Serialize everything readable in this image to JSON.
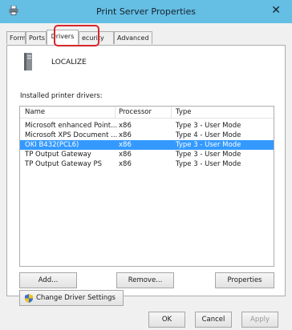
{
  "window": {
    "title": "Print Server Properties",
    "close_glyph": "✕"
  },
  "tabs": [
    {
      "label": "Forms"
    },
    {
      "label": "Ports"
    },
    {
      "label": "Drivers"
    },
    {
      "label": "ecurity"
    },
    {
      "label": "Advanced"
    }
  ],
  "active_tab": "Drivers",
  "server": {
    "name": "LOCALIZE",
    "icon": "print-server-icon"
  },
  "drivers_section": {
    "label": "Installed printer drivers:",
    "columns": [
      "Name",
      "Processor",
      "Type"
    ],
    "rows": [
      {
        "name": "Microsoft enhanced Point...",
        "processor": "x86",
        "type": "Type 3 - User Mode"
      },
      {
        "name": "Microsoft XPS Document ...",
        "processor": "x86",
        "type": "Type 4 - User Mode"
      },
      {
        "name": "OKI B432(PCL6)",
        "processor": "x86",
        "type": "Type 3 - User Mode"
      },
      {
        "name": "TP Output Gateway",
        "processor": "x86",
        "type": "Type 3 - User Mode"
      },
      {
        "name": "TP Output Gateway PS",
        "processor": "x86",
        "type": "Type 3 - User Mode"
      }
    ],
    "selected_row": 2
  },
  "buttons": {
    "add": "Add...",
    "remove": "Remove...",
    "properties": "Properties",
    "change_settings": "Change Driver Settings",
    "ok": "OK",
    "cancel": "Cancel",
    "apply": "Apply"
  },
  "colors": {
    "titlebar": "#65bee4",
    "selection": "#3399ff",
    "highlight_box": "#d6262b"
  }
}
